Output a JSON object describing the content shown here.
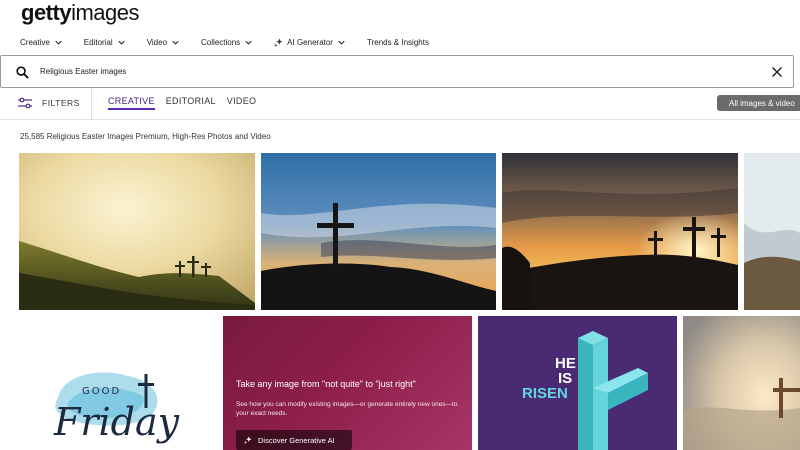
{
  "logo": {
    "bold": "getty",
    "light": "images"
  },
  "nav": [
    {
      "label": "Creative"
    },
    {
      "label": "Editorial"
    },
    {
      "label": "Video"
    },
    {
      "label": "Collections"
    },
    {
      "label": "AI Generator"
    },
    {
      "label": "Trends & Insights"
    }
  ],
  "search": {
    "value": "Religious Easter images"
  },
  "filters": {
    "label": "FILTERS",
    "tabs": [
      {
        "label": "CREATIVE",
        "active": true
      },
      {
        "label": "EDITORIAL",
        "active": false
      },
      {
        "label": "VIDEO",
        "active": false
      }
    ],
    "all_button": "All images & video"
  },
  "results": {
    "text": "25,585 Religious Easter Images Premium, High-Res Photos and Video"
  },
  "promo": {
    "title": "Take any image from \"not quite\" to \"just right\"",
    "subtitle": "See how you can modify existing images—or generate entirely new ones—to your exact needs.",
    "button": "Discover Generative AI"
  },
  "cards": {
    "good_friday": {
      "line1": "GOOD",
      "line2": "Friday"
    },
    "he_is_risen": {
      "line1": "HE",
      "line2": "IS",
      "line3": "RISEN"
    }
  },
  "colors": {
    "accent": "#5b2cb0",
    "promo": "#8d1f4a",
    "risen_bg": "#4a2a73",
    "risen_cross": "#65d3da"
  }
}
